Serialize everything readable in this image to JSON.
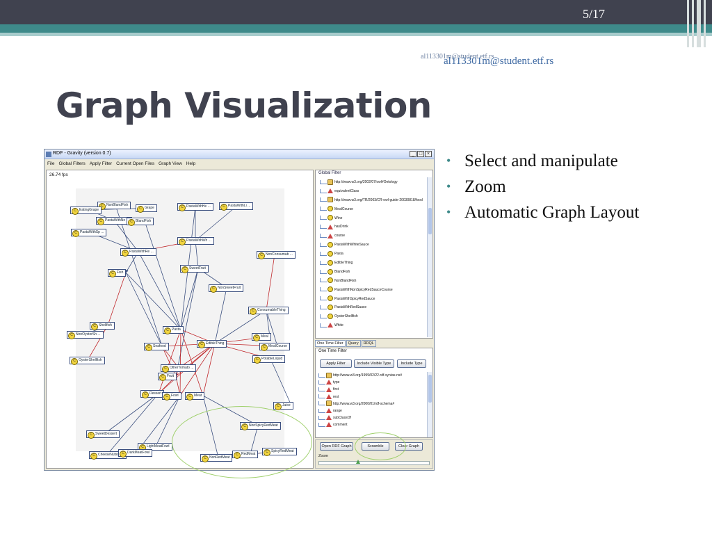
{
  "slide": {
    "page_number": "5/17",
    "email_ghost": "al113301m@student.etf.rs",
    "email": "al113301m@student.etf.rs",
    "title": "Graph Visualization",
    "bullets": [
      "Select and manipulate",
      "Zoom",
      "Automatic Graph Layout"
    ],
    "colors": {
      "header_dark": "#40424f",
      "header_teal": "#3e8a8a",
      "highlight_ellipse": "#9fd06b"
    }
  },
  "app": {
    "title": "RDF - Gravity (version 0.7)",
    "window_buttons": [
      "_",
      "□",
      "×"
    ],
    "menu": [
      "File",
      "Global Filters",
      "Apply Filter",
      "Current Open Files",
      "Graph View",
      "Help"
    ],
    "fps": "26.74 fps",
    "graph_nodes": [
      "NonBlandFish",
      "Grape",
      "EatingGrape",
      "PastaWithNo ...",
      "BlandFish",
      "PastaWithSp ...",
      "PastaWithHe ...",
      "PastaWithLi ...",
      "PastaWithWh ...",
      "PastaWithRe ...",
      "NonConsumab ...",
      "Fish",
      "SweetFruit",
      "NonSweetFruit",
      "ConsumableThing",
      "Shellfish",
      "NonOysterSh ...",
      "Pasta",
      "Meal",
      "Seafood",
      "EdibleThing",
      "MealCourse",
      "PotableLiquid",
      "OysterShellfish",
      "OtherTomato ...",
      "Fruit",
      "Dessert",
      "Fowl",
      "Meat",
      "Juice",
      "NonSpicyRedMeat",
      "SweetDessert",
      "LightMeatFowl",
      "SpicyRedMeat",
      "CheeseNutsD ...",
      "DarkMeatFowl",
      "RedMeat",
      "NonRedMeat"
    ],
    "global_filter": {
      "label": "Global Filter",
      "items": [
        {
          "text": "http://www.w3.org/2002/07/owl#Ontology",
          "icon": "ontology-icon"
        },
        {
          "text": "equivalentClass",
          "icon": "property-icon"
        },
        {
          "text": "http://www.w3.org/TR/2003/CR-owl-guide-20030818/food",
          "icon": "folder-icon"
        },
        {
          "text": "MealCourse",
          "icon": "class-icon"
        },
        {
          "text": "Wine",
          "icon": "class-icon"
        },
        {
          "text": "hasDrink",
          "icon": "property-icon"
        },
        {
          "text": "course",
          "icon": "property-icon"
        },
        {
          "text": "PastaWithWhiteSauce",
          "icon": "class-icon"
        },
        {
          "text": "Pasta",
          "icon": "class-icon"
        },
        {
          "text": "EdibleThing",
          "icon": "class-icon"
        },
        {
          "text": "BlandFish",
          "icon": "class-icon"
        },
        {
          "text": "NonBlandFish",
          "icon": "class-icon"
        },
        {
          "text": "PastaWithNonSpicyRedSauceCourse",
          "icon": "class-icon"
        },
        {
          "text": "PastaWithSpicyRedSauce",
          "icon": "class-icon"
        },
        {
          "text": "PastaWithRedSauce",
          "icon": "class-icon"
        },
        {
          "text": "OysterShellfish",
          "icon": "class-icon"
        },
        {
          "text": "White",
          "icon": "property-icon"
        }
      ]
    },
    "tabs": [
      "One Time Filter",
      "Query",
      "RDQL"
    ],
    "one_time_filter": {
      "label": "One Time Filter",
      "buttons": [
        "Apply Filter",
        "Include Visible Type",
        "Include Type"
      ],
      "items": [
        {
          "text": "http://www.w3.org/1999/02/22-rdf-syntax-ns#",
          "icon": "folder-icon"
        },
        {
          "text": "type",
          "icon": "property-icon"
        },
        {
          "text": "first",
          "icon": "property-icon"
        },
        {
          "text": "rest",
          "icon": "property-icon"
        },
        {
          "text": "http://www.w3.org/2000/01/rdf-schema#",
          "icon": "folder-icon"
        },
        {
          "text": "range",
          "icon": "property-icon"
        },
        {
          "text": "subClassOf",
          "icon": "property-icon"
        },
        {
          "text": "comment",
          "icon": "property-icon"
        }
      ]
    },
    "bottom_buttons": [
      "Open RDF Graph",
      "Scramble",
      "Clear Graph"
    ],
    "zoom_label": "Zoom",
    "zoom_level": 0.35
  }
}
